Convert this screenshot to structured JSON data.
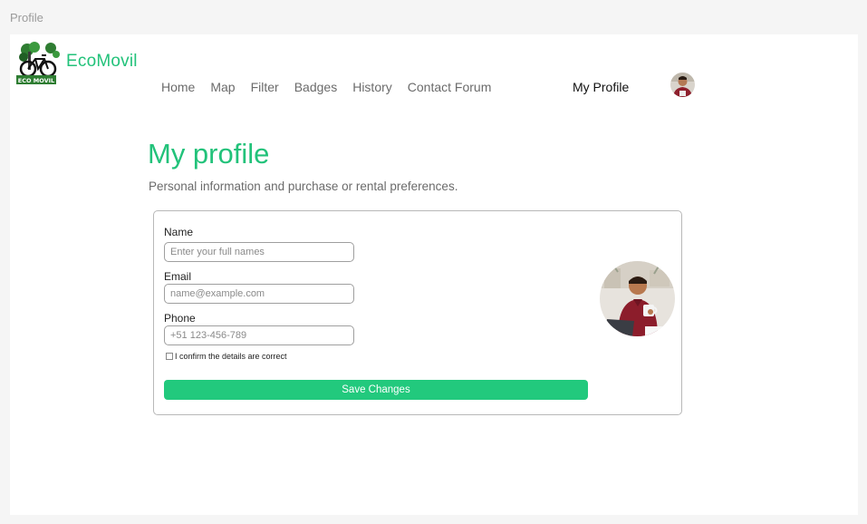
{
  "frame_label": "Profile",
  "brand": {
    "name": "EcoMovil",
    "badge_text": "ECO MOVIL",
    "accent_color": "#22c27a"
  },
  "nav": {
    "items": [
      {
        "label": "Home"
      },
      {
        "label": "Map"
      },
      {
        "label": "Filter"
      },
      {
        "label": "Badges"
      },
      {
        "label": "History"
      },
      {
        "label": "Contact Forum"
      }
    ],
    "profile_label": "My Profile",
    "avatar_icon": "user-avatar"
  },
  "page": {
    "title": "My profile",
    "subtitle": "Personal information and purchase or rental preferences."
  },
  "form": {
    "name": {
      "label": "Name",
      "placeholder": "Enter your full names",
      "value": ""
    },
    "email": {
      "label": "Email",
      "placeholder": "name@example.com",
      "value": ""
    },
    "phone": {
      "label": "Phone",
      "placeholder": "+51 123-456-789",
      "value": ""
    },
    "confirm_label": "I confirm the details are correct",
    "confirm_checked": false,
    "save_label": "Save Changes",
    "save_color": "#22c97d"
  },
  "profile_photo_icon": "profile-photo"
}
